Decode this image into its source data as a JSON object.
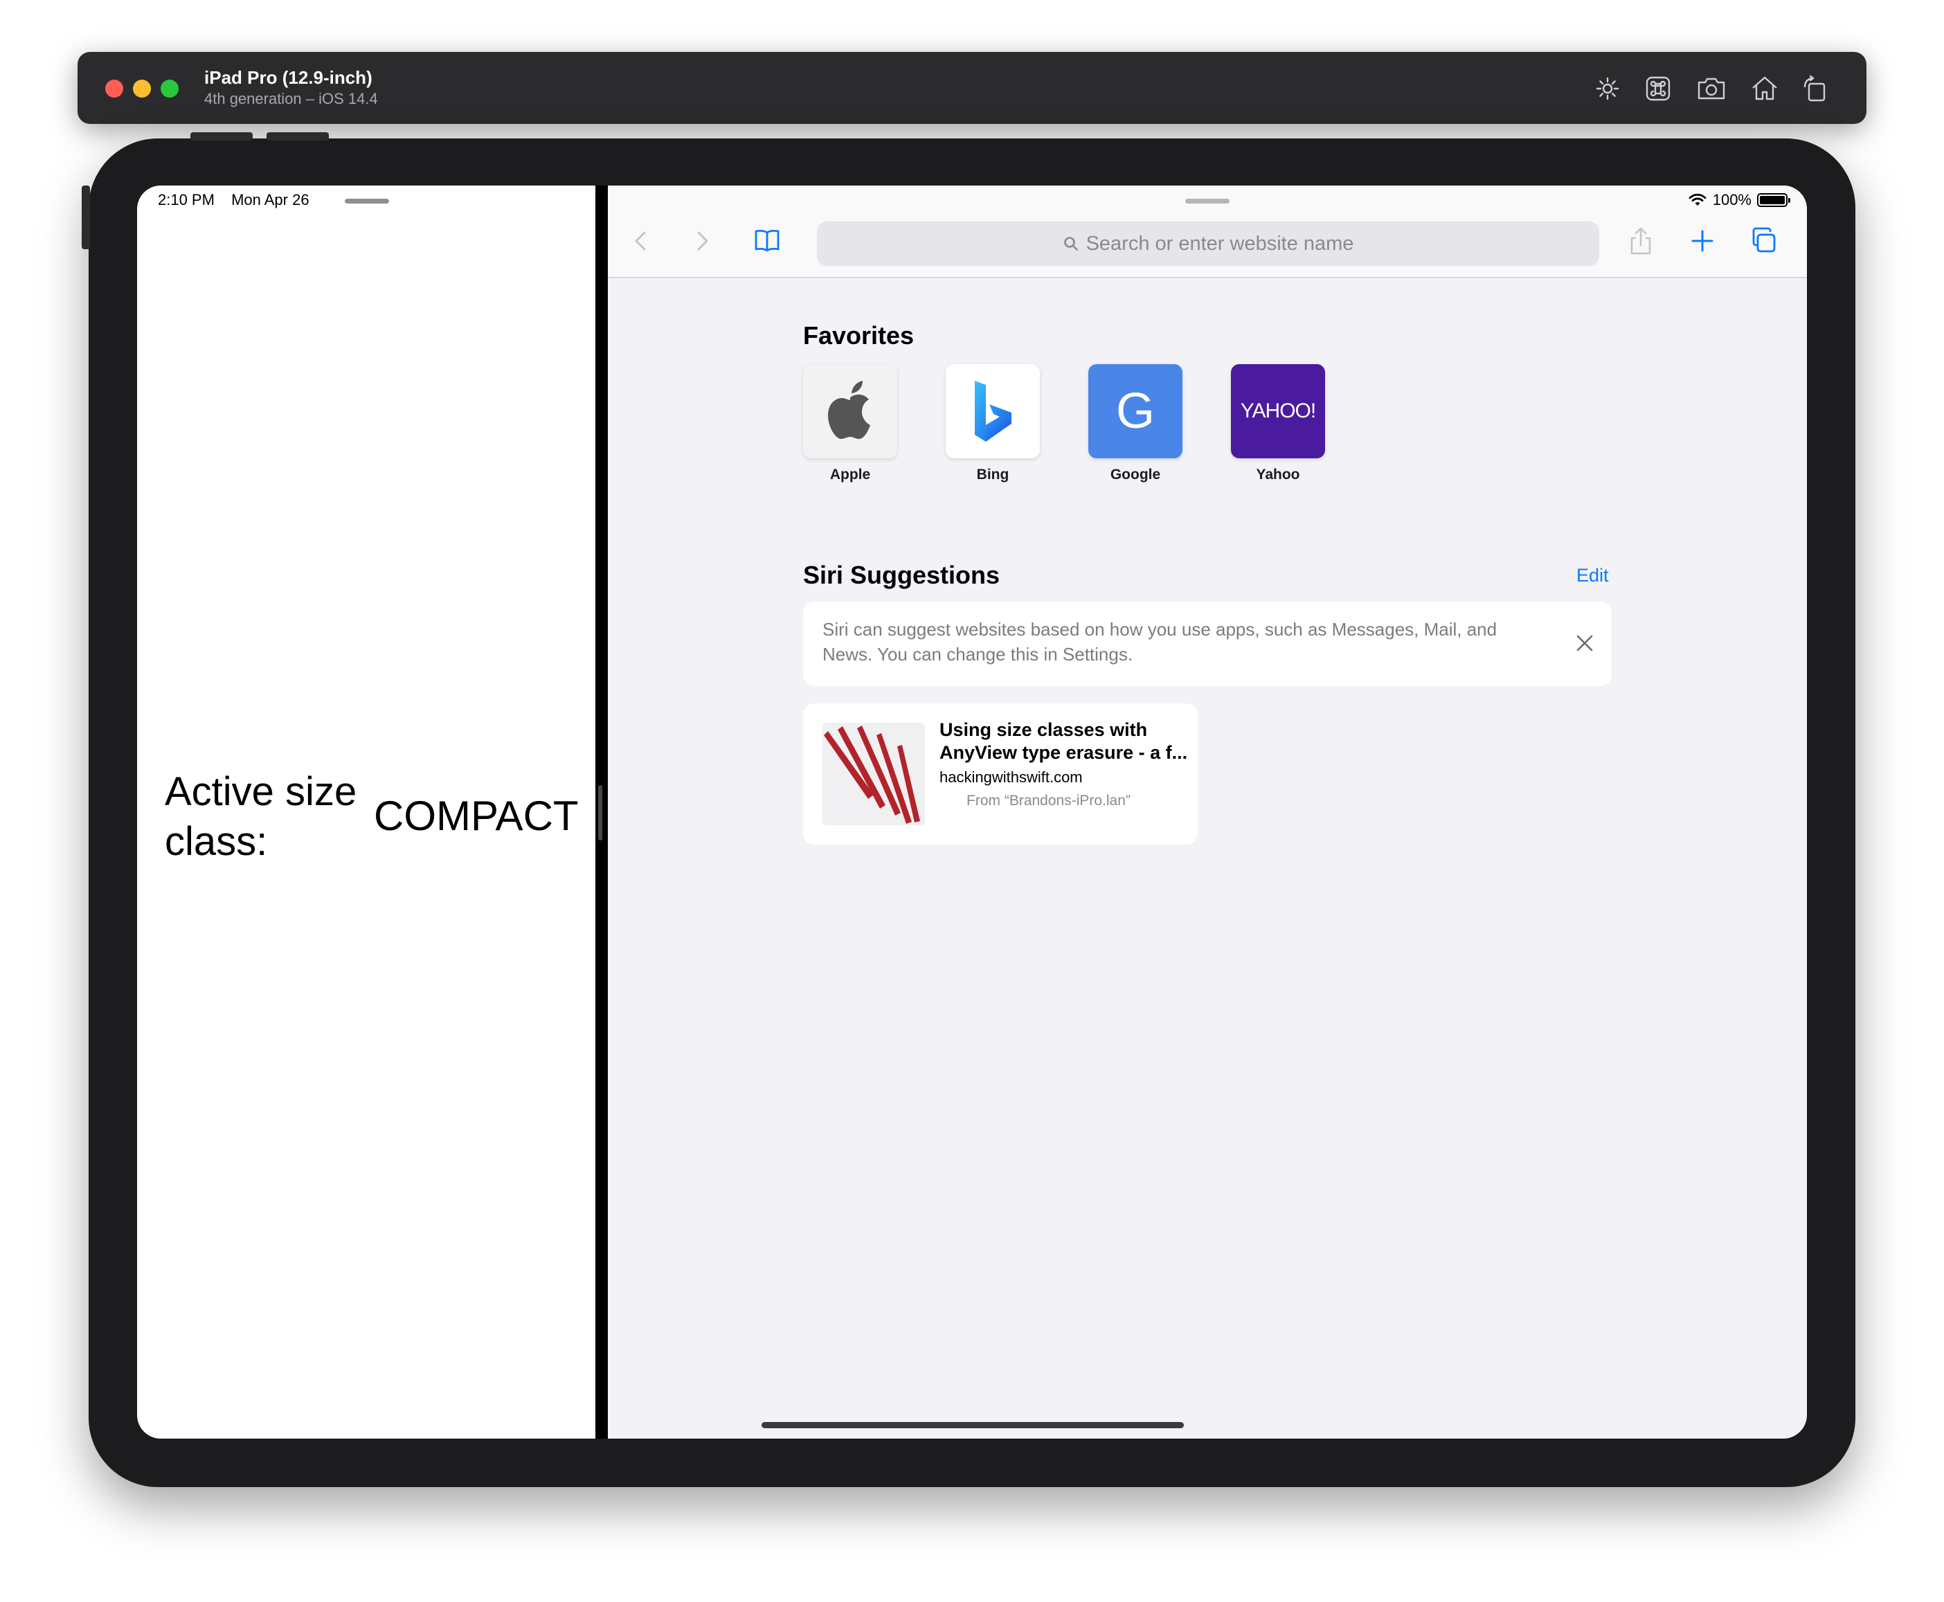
{
  "window": {
    "title": "iPad Pro (12.9-inch)",
    "subtitle": "4th generation – iOS 14.4",
    "toolbar_icons": [
      "brightness-icon",
      "command-key-icon",
      "screenshot-icon",
      "home-icon",
      "rotate-icon"
    ]
  },
  "left_app": {
    "status": {
      "time": "2:10 PM",
      "date": "Mon Apr 26"
    },
    "label": "Active size class:",
    "value": "COMPACT"
  },
  "safari": {
    "status": {
      "battery": "100%"
    },
    "search_placeholder": "Search or enter website name",
    "favorites_title": "Favorites",
    "favorites": [
      {
        "label": "Apple",
        "icon": "apple-logo",
        "bg": "#f2f2f2"
      },
      {
        "label": "Bing",
        "icon": "bing-logo",
        "bg": "#ffffff"
      },
      {
        "label": "Google",
        "icon": "google-letter",
        "glyph": "G",
        "bg": "#4a86e8"
      },
      {
        "label": "Yahoo",
        "icon": "yahoo-logo",
        "glyph": "YAHOO!",
        "bg": "#4b1b9f"
      }
    ],
    "siri_title": "Siri Suggestions",
    "edit_label": "Edit",
    "siri_info": "Siri can suggest websites based on how you use apps, such as Messages, Mail, and News. You can change this in Settings.",
    "suggestion": {
      "title": "Using size classes with AnyView type erasure - a f...",
      "domain": "hackingwithswift.com",
      "from": "From “Brandons-iPro.lan”"
    },
    "accent": "#0a7aff"
  }
}
